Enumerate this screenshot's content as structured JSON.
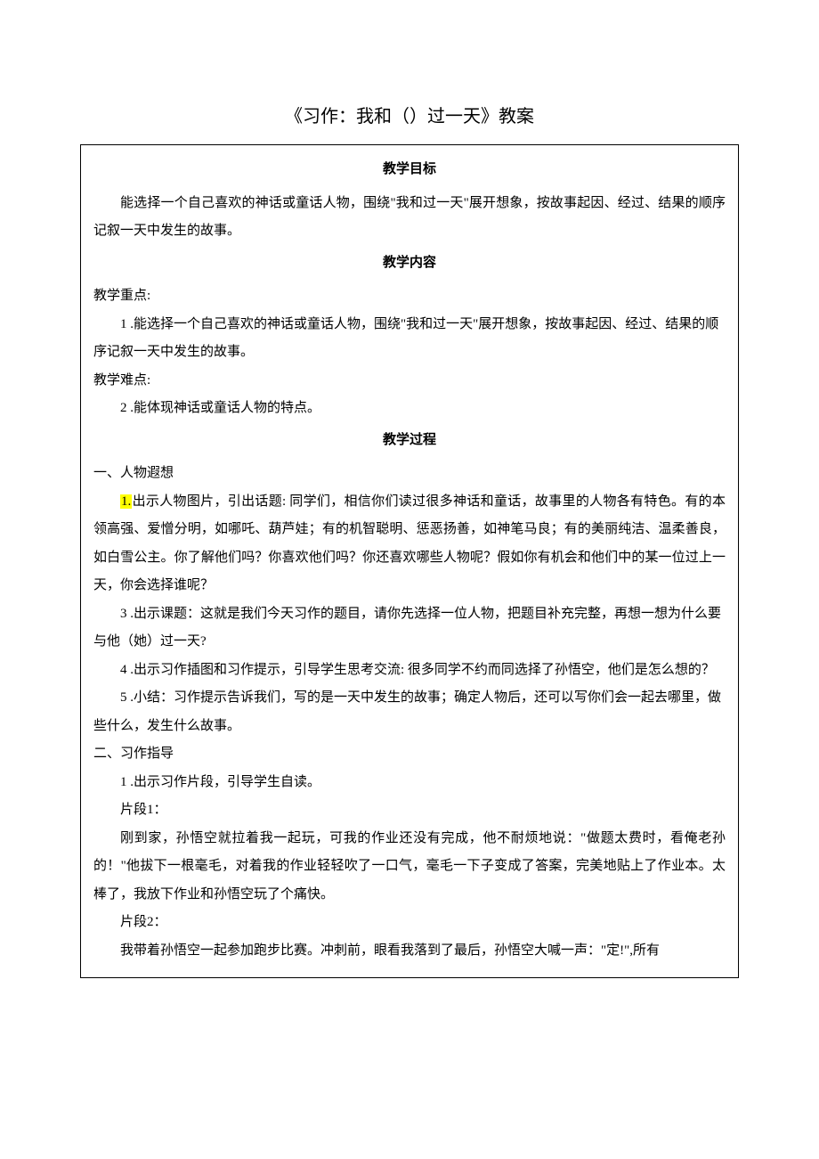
{
  "title": "《习作：我和（）过一天》教案",
  "headings": {
    "objective": "教学目标",
    "content": "教学内容",
    "process": "教学过程"
  },
  "objective_text": "能选择一个自己喜欢的神话或童话人物，围绕\"我和过一天\"展开想象，按故事起因、经过、结果的顺序记叙一天中发生的故事。",
  "content_labels": {
    "keypoint": "教学重点:",
    "difficulty": "教学难点:"
  },
  "keypoint_item": "1 .能选择一个自己喜欢的神话或童话人物，围绕\"我和过一天\"展开想象，按故事起因、经过、结果的顺序记叙一天中发生的故事。",
  "difficulty_item": "2 .能体现神话或童话人物的特点。",
  "section1_title": "一、人物遐想",
  "section1": {
    "n1_highlight": "1.",
    "n1_text": "出示人物图片，引出话题: 同学们，相信你们读过很多神话和童话，故事里的人物各有特色。有的本领高强、爱憎分明，如哪吒、葫芦娃；有的机智聪明、惩恶扬善，如神笔马良；有的美丽纯洁、温柔善良，如白雪公主。你了解他们吗？你喜欢他们吗？你还喜欢哪些人物呢？假如你有机会和他们中的某一位过上一天，你会选择谁呢？",
    "n3": "3 .出示课题：这就是我们今天习作的题目，请你先选择一位人物，把题目补充完整，再想一想为什么要与他（她）过一天?",
    "n4": "4 .出示习作插图和习作提示，引导学生思考交流: 很多同学不约而同选择了孙悟空，他们是怎么想的？",
    "n5": "5 .小结：习作提示告诉我们，写的是一天中发生的故事；确定人物后，还可以写你们会一起去哪里，做些什么，发生什么故事。"
  },
  "section2_title": "二、习作指导",
  "section2": {
    "n1": "1 .出示习作片段，引导学生自读。",
    "frag1_label": "片段1：",
    "frag1_text": "刚到家，孙悟空就拉着我一起玩，可我的作业还没有完成，他不耐烦地说：\"做题太费时，看俺老孙的！\"他拔下一根毫毛，对着我的作业轻轻吹了一口气，毫毛一下子变成了答案，完美地贴上了作业本。太棒了，我放下作业和孙悟空玩了个痛快。",
    "frag2_label": "片段2：",
    "frag2_text": "我带着孙悟空一起参加跑步比赛。冲刺前，眼看我落到了最后，孙悟空大喊一声：\"定!\",所有"
  }
}
